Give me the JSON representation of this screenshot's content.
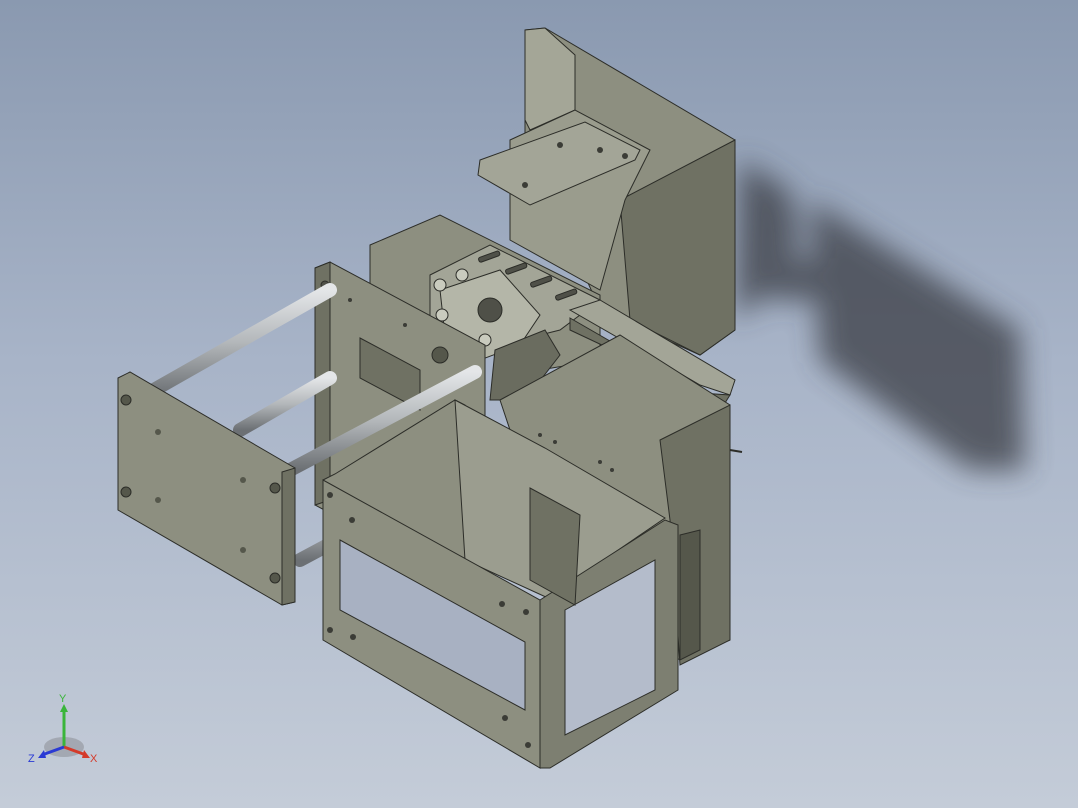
{
  "viewport": {
    "background_top": "#8a99b0",
    "background_bottom": "#c4ccd8"
  },
  "model": {
    "part_color": "#8d8f80",
    "part_dark": "#6f7163",
    "part_light": "#a3a597",
    "rod_color": "#b8bcbf",
    "shadow_color": "#3a3d44"
  },
  "triad": {
    "x_label": "X",
    "y_label": "Y",
    "z_label": "Z",
    "x_color": "#d43a2a",
    "y_color": "#3ab53a",
    "z_color": "#2a3ad4"
  }
}
